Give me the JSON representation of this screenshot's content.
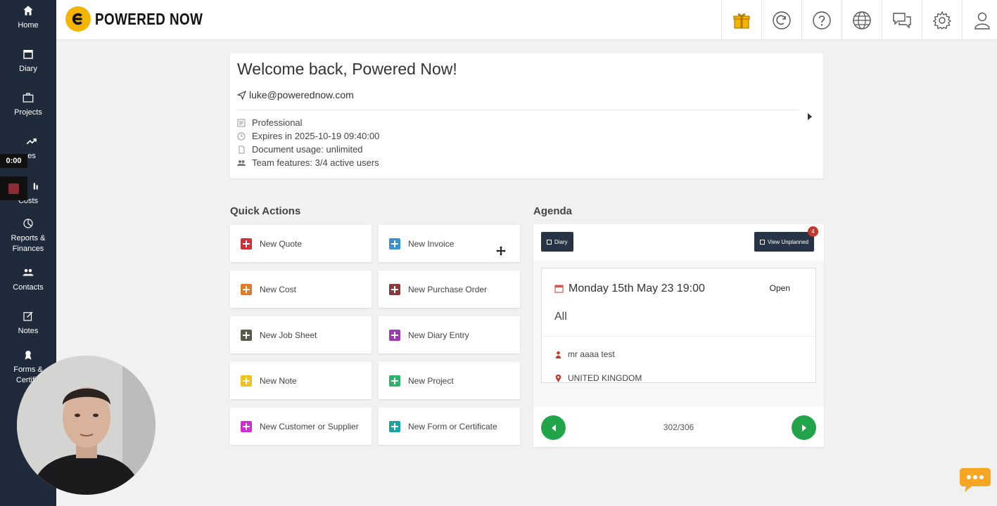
{
  "app": {
    "brand": "POWERED NOW"
  },
  "sidebar": {
    "items": [
      {
        "label": "Home",
        "icon": "home-icon"
      },
      {
        "label": "Diary",
        "icon": "calendar-icon"
      },
      {
        "label": "Projects",
        "icon": "briefcase-icon"
      },
      {
        "label": "es",
        "icon": "trending-up-icon"
      },
      {
        "label": "Costs",
        "icon": "bar-chart-icon"
      },
      {
        "label": "Reports &\nFinances",
        "icon": "pie-chart-icon"
      },
      {
        "label": "Contacts",
        "icon": "people-icon"
      },
      {
        "label": "Notes",
        "icon": "edit-icon"
      },
      {
        "label": "Forms &\nCertific",
        "icon": "award-icon"
      }
    ]
  },
  "recording": {
    "timer": "0:00"
  },
  "topbar": {
    "icons": [
      "gift-icon",
      "refresh-icon",
      "help-icon",
      "globe-icon",
      "chat-icon",
      "settings-icon",
      "user-icon"
    ]
  },
  "welcome": {
    "title": "Welcome back, Powered Now!",
    "email": "luke@powerednow.com",
    "plan": "Professional",
    "expires": "Expires in 2025-10-19 09:40:00",
    "document_usage": "Document usage: unlimited",
    "team": "Team features: 3/4 active users"
  },
  "quick_actions": {
    "title": "Quick Actions",
    "items": [
      {
        "label": "New Quote",
        "color": "#d0303a"
      },
      {
        "label": "New Invoice",
        "color": "#3a8fd0"
      },
      {
        "label": "New Cost",
        "color": "#e07b2a"
      },
      {
        "label": "New Purchase Order",
        "color": "#8b3a3a"
      },
      {
        "label": "New Job Sheet",
        "color": "#5a5a4a"
      },
      {
        "label": "New Diary Entry",
        "color": "#9b3db0"
      },
      {
        "label": "New Note",
        "color": "#f2c21b"
      },
      {
        "label": "New Project",
        "color": "#2db36a"
      },
      {
        "label": "New Customer or Supplier",
        "color": "#d02fd0"
      },
      {
        "label": "New Form or Certificate",
        "color": "#1aa3a3"
      }
    ]
  },
  "agenda": {
    "title": "Agenda",
    "diary_button": "Diary",
    "view_unplanned_button": "View Unplanned",
    "unplanned_count": "4",
    "event": {
      "date": "Monday 15th May 23 19:00",
      "status": "Open",
      "assignee": "All",
      "contact": "mr aaaa test",
      "location": "UNITED KINGDOM"
    },
    "pager": "302/306"
  },
  "colors": {
    "accent": "#f4b400",
    "sidebar": "#1f2b3a",
    "green": "#22a54a"
  }
}
